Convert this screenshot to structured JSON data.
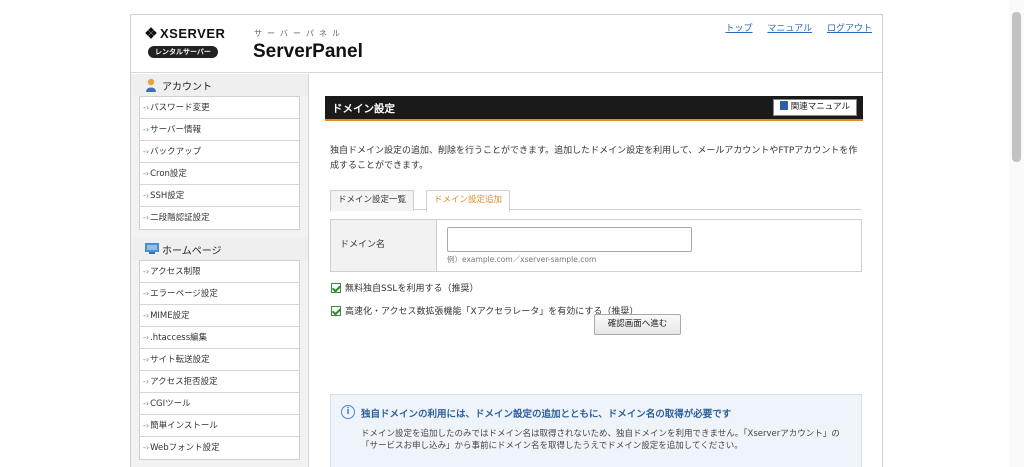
{
  "header": {
    "brand": "XSERVER",
    "badge": "レンタルサーバー",
    "subtitle": "サーバーパネル",
    "product": "ServerPanel",
    "links": [
      "トップ",
      "マニュアル",
      "ログアウト"
    ]
  },
  "sidebar": {
    "sections": [
      {
        "title": "アカウント",
        "items": [
          "パスワード変更",
          "サーバー情報",
          "バックアップ",
          "Cron設定",
          "SSH設定",
          "二段階認証設定"
        ]
      },
      {
        "title": "ホームページ",
        "items": [
          "アクセス制限",
          "エラーページ設定",
          "MIME設定",
          ".htaccess編集",
          "サイト転送設定",
          "アクセス拒否設定",
          "CGIツール",
          "簡単インストール",
          "Webフォント設定"
        ]
      }
    ]
  },
  "main": {
    "title": "ドメイン設定",
    "manual_button": "関連マニュアル",
    "description": "独自ドメイン設定の追加、削除を行うことができます。追加したドメイン設定を利用して、メールアカウントやFTPアカウントを作成することができます。",
    "tabs": [
      {
        "label": "ドメイン設定一覧",
        "active": false
      },
      {
        "label": "ドメイン設定追加",
        "active": true
      }
    ],
    "form": {
      "label": "ドメイン名",
      "value": "",
      "hint": "例）example.com／xserver-sample.com"
    },
    "options": [
      {
        "label": "無料独自SSLを利用する（推奨）",
        "checked": true
      },
      {
        "label": "高速化・アクセス数拡張機能「Xアクセラレータ」を有効にする（推奨）",
        "checked": true
      }
    ],
    "confirm_button": "確認画面へ進む",
    "notice": {
      "title": "独自ドメインの利用には、ドメイン設定の追加とともに、ドメイン名の取得が必要です",
      "body": "ドメイン設定を追加したのみではドメイン名は取得されないため、独自ドメインを利用できません。「Xserverアカウント」の「サービスお申し込み」から事前にドメイン名を取得したうえでドメイン設定を追加してください。"
    }
  }
}
